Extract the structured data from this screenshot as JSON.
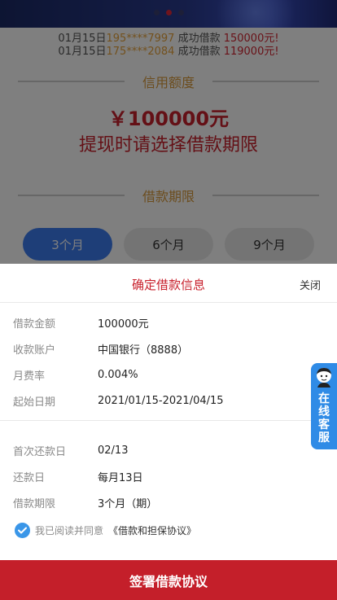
{
  "ticker": [
    {
      "date": "01月15日",
      "phone": "195****7997",
      "action": "成功借款",
      "amount": "150000元!"
    },
    {
      "date": "01月15日",
      "phone": "175****2084",
      "action": "成功借款",
      "amount": "119000元!"
    }
  ],
  "credit": {
    "heading": "信用额度",
    "amount": "￥100000元",
    "hint": "提现时请选择借款期限"
  },
  "term": {
    "heading": "借款期限",
    "options": [
      "3个月",
      "6个月",
      "9个月"
    ],
    "selected_index": 0
  },
  "sheet": {
    "title": "确定借款信息",
    "close_label": "关闭",
    "info_rows": [
      {
        "label": "借款金额",
        "value": "100000元"
      },
      {
        "label": "收款账户",
        "value": "中国银行（8888）"
      },
      {
        "label": "月费率",
        "value": "0.004%"
      },
      {
        "label": "起始日期",
        "value": "2021/01/15-2021/04/15"
      }
    ],
    "repay_rows": [
      {
        "label": "首次还款日",
        "value": "02/13"
      },
      {
        "label": "还款日",
        "value": "每月13日"
      },
      {
        "label": "借款期限",
        "value": "3个月（期）"
      }
    ],
    "agree_text": "我已阅读并同意",
    "agree_link": "《借款和担保协议》",
    "agree_checked": true,
    "sign_button": "签署借款协议"
  },
  "customer_service": {
    "label": "在线客服"
  },
  "colors": {
    "brand_red": "#c41f2a",
    "accent_gold": "#d89a3c",
    "selected_blue": "#3d7cf0",
    "check_blue": "#3a96e8"
  }
}
